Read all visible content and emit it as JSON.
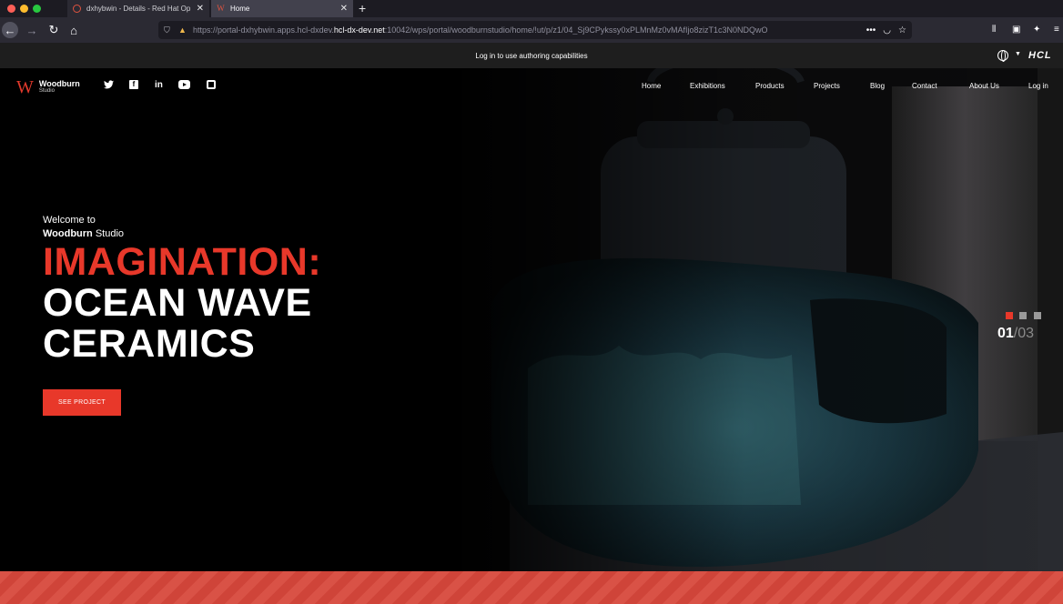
{
  "browser": {
    "tabs": [
      {
        "title": "dxhybwin - Details - Red Hat Op",
        "active": false
      },
      {
        "title": "Home",
        "active": true
      }
    ],
    "url": {
      "prefix": "https://portal-dxhybwin.apps.hcl-dxdev.",
      "domain": "hcl-dx-dev.net",
      "rest": ":10042/wps/portal/woodburnstudio/home/!ut/p/z1/04_Sj9CPykssy0xPLMnMz0vMAfIjo8zizT1c3N0NDQwO"
    },
    "toolbar_icons": [
      "back-icon",
      "forward-icon",
      "reload-icon",
      "home-icon",
      "shield-icon",
      "lock-warning-icon",
      "more-icon",
      "pocket-icon",
      "bookmark-star-icon",
      "library-icon",
      "sidebar-icon",
      "extensions-icon",
      "menu-icon"
    ]
  },
  "notification": {
    "text": "Log in to use authoring capabilities",
    "brand": "HCL"
  },
  "site": {
    "logo": {
      "mark": "W",
      "name": "Woodburn",
      "subtitle": "Studio"
    },
    "social": [
      "twitter-icon",
      "facebook-icon",
      "linkedin-icon",
      "youtube-icon",
      "instagram-icon"
    ],
    "social_labels": {
      "facebook": "f",
      "linkedin": "in",
      "twitter": "t"
    },
    "nav": [
      "Home",
      "Exhibitions",
      "Products",
      "Projects",
      "Blog",
      "Contact",
      "About Us",
      "Log in"
    ],
    "hero": {
      "welcome": "Welcome to",
      "studio_bold": "Woodburn",
      "studio_rest": " Studio",
      "headline_red": "IMAGINATION:",
      "headline_line2": "OCEAN WAVE",
      "headline_line3": "CERAMICS",
      "cta": "SEE PROJECT",
      "slide_current": "01",
      "slide_total": "/03",
      "slides": 3,
      "active_slide": 1
    },
    "colors": {
      "accent": "#e8382a",
      "background": "#000000"
    }
  }
}
